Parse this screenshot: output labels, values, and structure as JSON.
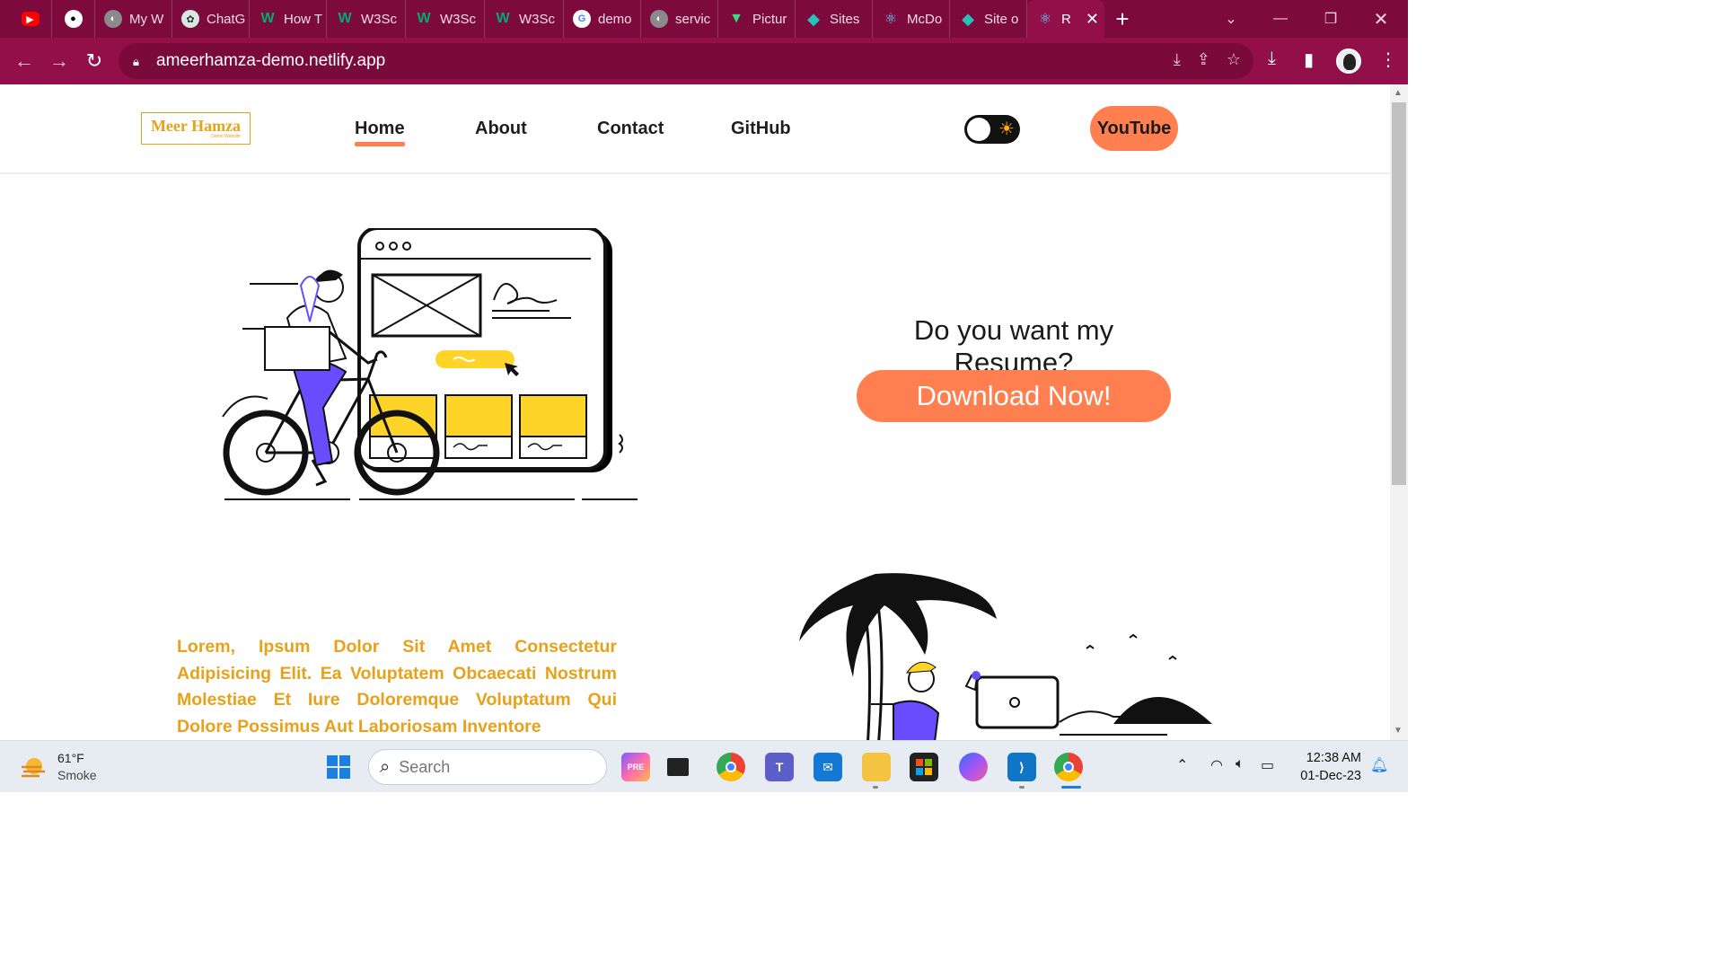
{
  "browser": {
    "tabs": [
      {
        "label": "",
        "icon": "youtube-icon"
      },
      {
        "label": "",
        "icon": "github-icon"
      },
      {
        "label": "My W",
        "icon": "globe-icon"
      },
      {
        "label": "ChatG",
        "icon": "chatgpt-icon"
      },
      {
        "label": "How T",
        "icon": "w3schools-icon"
      },
      {
        "label": "W3Sc",
        "icon": "w3schools-icon"
      },
      {
        "label": "W3Sc",
        "icon": "w3schools-icon"
      },
      {
        "label": "W3Sc",
        "icon": "w3schools-icon"
      },
      {
        "label": "demo",
        "icon": "google-icon"
      },
      {
        "label": "servic",
        "icon": "globe-icon"
      },
      {
        "label": "Pictur",
        "icon": "vite-icon"
      },
      {
        "label": "Sites",
        "icon": "netlify-icon"
      },
      {
        "label": "McDo",
        "icon": "react-icon"
      },
      {
        "label": "Site o",
        "icon": "netlify-icon"
      },
      {
        "label": "R",
        "icon": "react-icon",
        "active": true
      }
    ],
    "url": "ameerhamza-demo.netlify.app",
    "theme_color": "#920f4a"
  },
  "site": {
    "logo_name": "Meer Hamza",
    "logo_sub": "Demo Website",
    "nav": [
      "Home",
      "About",
      "Contact",
      "GitHub"
    ],
    "active_nav": "Home",
    "youtube_button": "YouTube",
    "resume_question": "Do you want my Resume?",
    "download_button": "Download Now!",
    "lorem_text": "Lorem, Ipsum Dolor Sit Amet Consectetur Adipisicing Elit. Ea Voluptatem Obcaecati Nostrum Molestiae Et Iure Doloremque Voluptatum Qui Dolore Possimus Aut Laboriosam Inventore",
    "accent_color": "#ff7f50",
    "gold_color": "#e8a11a"
  },
  "taskbar": {
    "weather_temp": "61°F",
    "weather_condition": "Smoke",
    "search_placeholder": "Search",
    "time": "12:38 AM",
    "date": "01-Dec-23"
  }
}
